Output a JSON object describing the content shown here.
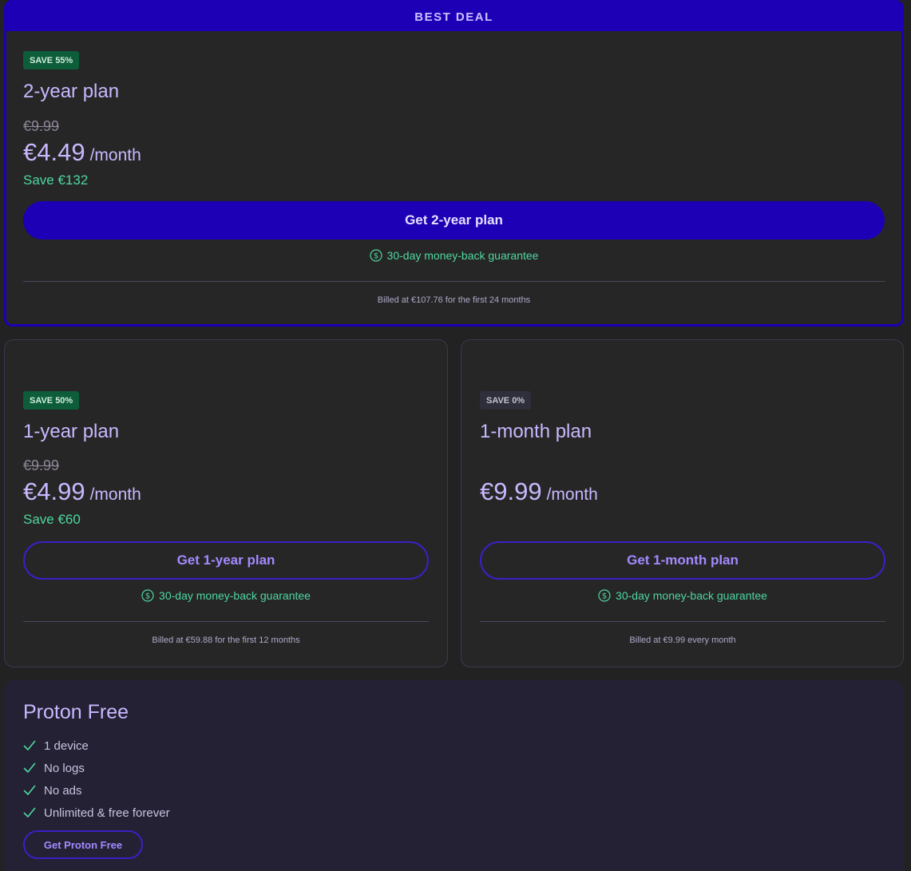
{
  "best_deal": {
    "header": "BEST DEAL",
    "badge": "SAVE 55%",
    "title": "2-year plan",
    "old_price": "€9.99",
    "price": "€4.49",
    "per": "/month",
    "save": "Save €132",
    "button": "Get 2-year plan",
    "guarantee": "30-day money-back guarantee",
    "billed": "Billed at €107.76 for the first 24 months"
  },
  "plan_1y": {
    "badge": "SAVE 50%",
    "title": "1-year plan",
    "old_price": "€9.99",
    "price": "€4.99",
    "per": "/month",
    "save": "Save €60",
    "button": "Get 1-year plan",
    "guarantee": "30-day money-back guarantee",
    "billed": "Billed at €59.88 for the first 12 months"
  },
  "plan_1m": {
    "badge": "SAVE 0%",
    "title": "1-month plan",
    "price": "€9.99",
    "per": "/month",
    "button": "Get 1-month plan",
    "guarantee": "30-day money-back guarantee",
    "billed": "Billed at €9.99 every month"
  },
  "free": {
    "title": "Proton Free",
    "features": [
      "1 device",
      "No logs",
      "No ads",
      "Unlimited & free forever"
    ],
    "button": "Get Proton Free"
  },
  "colors": {
    "accent": "#1d00b5",
    "save_green": "#4fd6a0",
    "badge_green": "#0d5c3a",
    "card_bg": "#262626",
    "free_bg": "#232133"
  },
  "icons": {
    "guarantee": "dollar-circle-icon",
    "feature": "checkmark-icon"
  }
}
